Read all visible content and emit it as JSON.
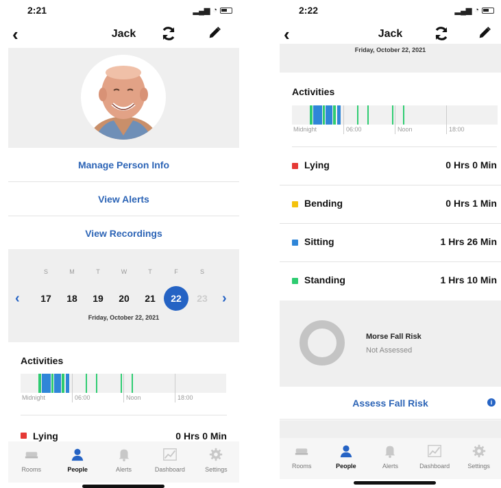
{
  "left": {
    "status": {
      "time": "2:21"
    },
    "nav": {
      "title": "Jack"
    },
    "links": {
      "manage": "Manage Person Info",
      "alerts": "View Alerts",
      "recordings": "View Recordings"
    },
    "calendar": {
      "weekdays": [
        "S",
        "M",
        "T",
        "W",
        "T",
        "F",
        "S"
      ],
      "days": [
        "17",
        "18",
        "19",
        "20",
        "21",
        "22",
        "23"
      ],
      "selected_day": "22",
      "date_label": "Friday, October 22, 2021"
    },
    "activities": {
      "title": "Activities",
      "timeline_labels": [
        "Midnight",
        "06:00",
        "Noon",
        "18:00"
      ],
      "rows": [
        {
          "name": "Lying",
          "value": "0 Hrs 0 Min",
          "color": "#e53935"
        }
      ]
    }
  },
  "right": {
    "status": {
      "time": "2:22"
    },
    "nav": {
      "title": "Jack"
    },
    "date_label": "Friday, October 22, 2021",
    "activities": {
      "title": "Activities",
      "timeline_labels": [
        "Midnight",
        "06:00",
        "Noon",
        "18:00"
      ],
      "rows": [
        {
          "name": "Lying",
          "value": "0 Hrs 0 Min",
          "color": "#e53935"
        },
        {
          "name": "Bending",
          "value": "0 Hrs 1 Min",
          "color": "#f4c20d"
        },
        {
          "name": "Sitting",
          "value": "1 Hrs 26 Min",
          "color": "#2f86d8"
        },
        {
          "name": "Standing",
          "value": "1 Hrs 10 Min",
          "color": "#2ecc71"
        }
      ]
    },
    "fall_risk": {
      "title": "Morse Fall Risk",
      "status": "Not Assessed",
      "assess_label": "Assess Fall Risk",
      "info_icon": "info-icon"
    }
  },
  "tabbar": {
    "items": [
      {
        "label": "Rooms",
        "icon": "bed-icon"
      },
      {
        "label": "People",
        "icon": "person-icon"
      },
      {
        "label": "Alerts",
        "icon": "bell-icon"
      },
      {
        "label": "Dashboard",
        "icon": "chart-icon"
      },
      {
        "label": "Settings",
        "icon": "gear-icon"
      }
    ],
    "active": "People"
  },
  "colors": {
    "accent": "#2563c4",
    "link": "#2c64b6",
    "timeline_blue": "#2f86d8",
    "timeline_green": "#2ecc71"
  }
}
